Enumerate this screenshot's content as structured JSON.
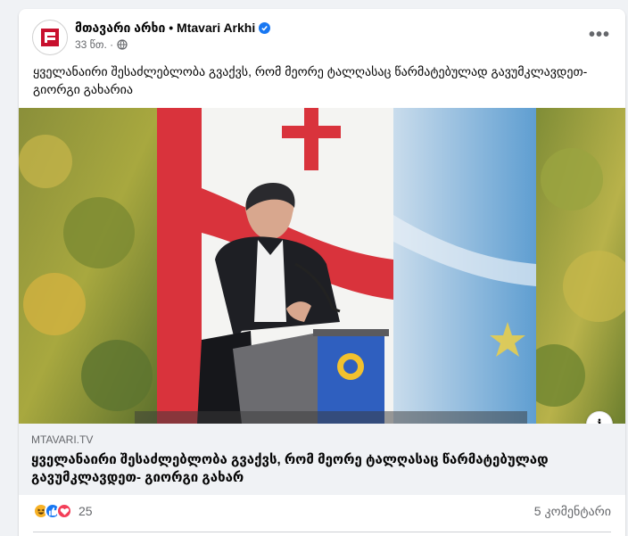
{
  "post": {
    "page_name": "მთავარი არხი • Mtavari Arkhi",
    "time": "33 წთ. ·",
    "text": "ყველანაირი შესაძლებლობა გვაქვს, რომ მეორე ტალღასაც წარმატებულად გავუმკლავდეთ- გიორგი გახარია"
  },
  "link_preview": {
    "domain": "MTAVARI.TV",
    "title": "ყველანაირი შესაძლებლობა გვაქვს, რომ მეორე ტალღასაც წარმატებულად გავუმკლავდეთ- გიორგი გახარ"
  },
  "engagement": {
    "reaction_count": "25",
    "comment_count": "5 კომენტარი"
  },
  "icons": {
    "page_avatar": "mtavari-logo-icon",
    "verified": "verified-badge-icon",
    "audience": "globe-icon",
    "more": "more-options-icon",
    "info": "info-icon",
    "reactions": [
      "haha-icon",
      "like-icon",
      "love-icon"
    ]
  },
  "colors": {
    "brand_red": "#c8102e",
    "facebook_blue": "#1877f2",
    "love_red": "#f33e58",
    "haha_yellow": "#f7b125"
  }
}
